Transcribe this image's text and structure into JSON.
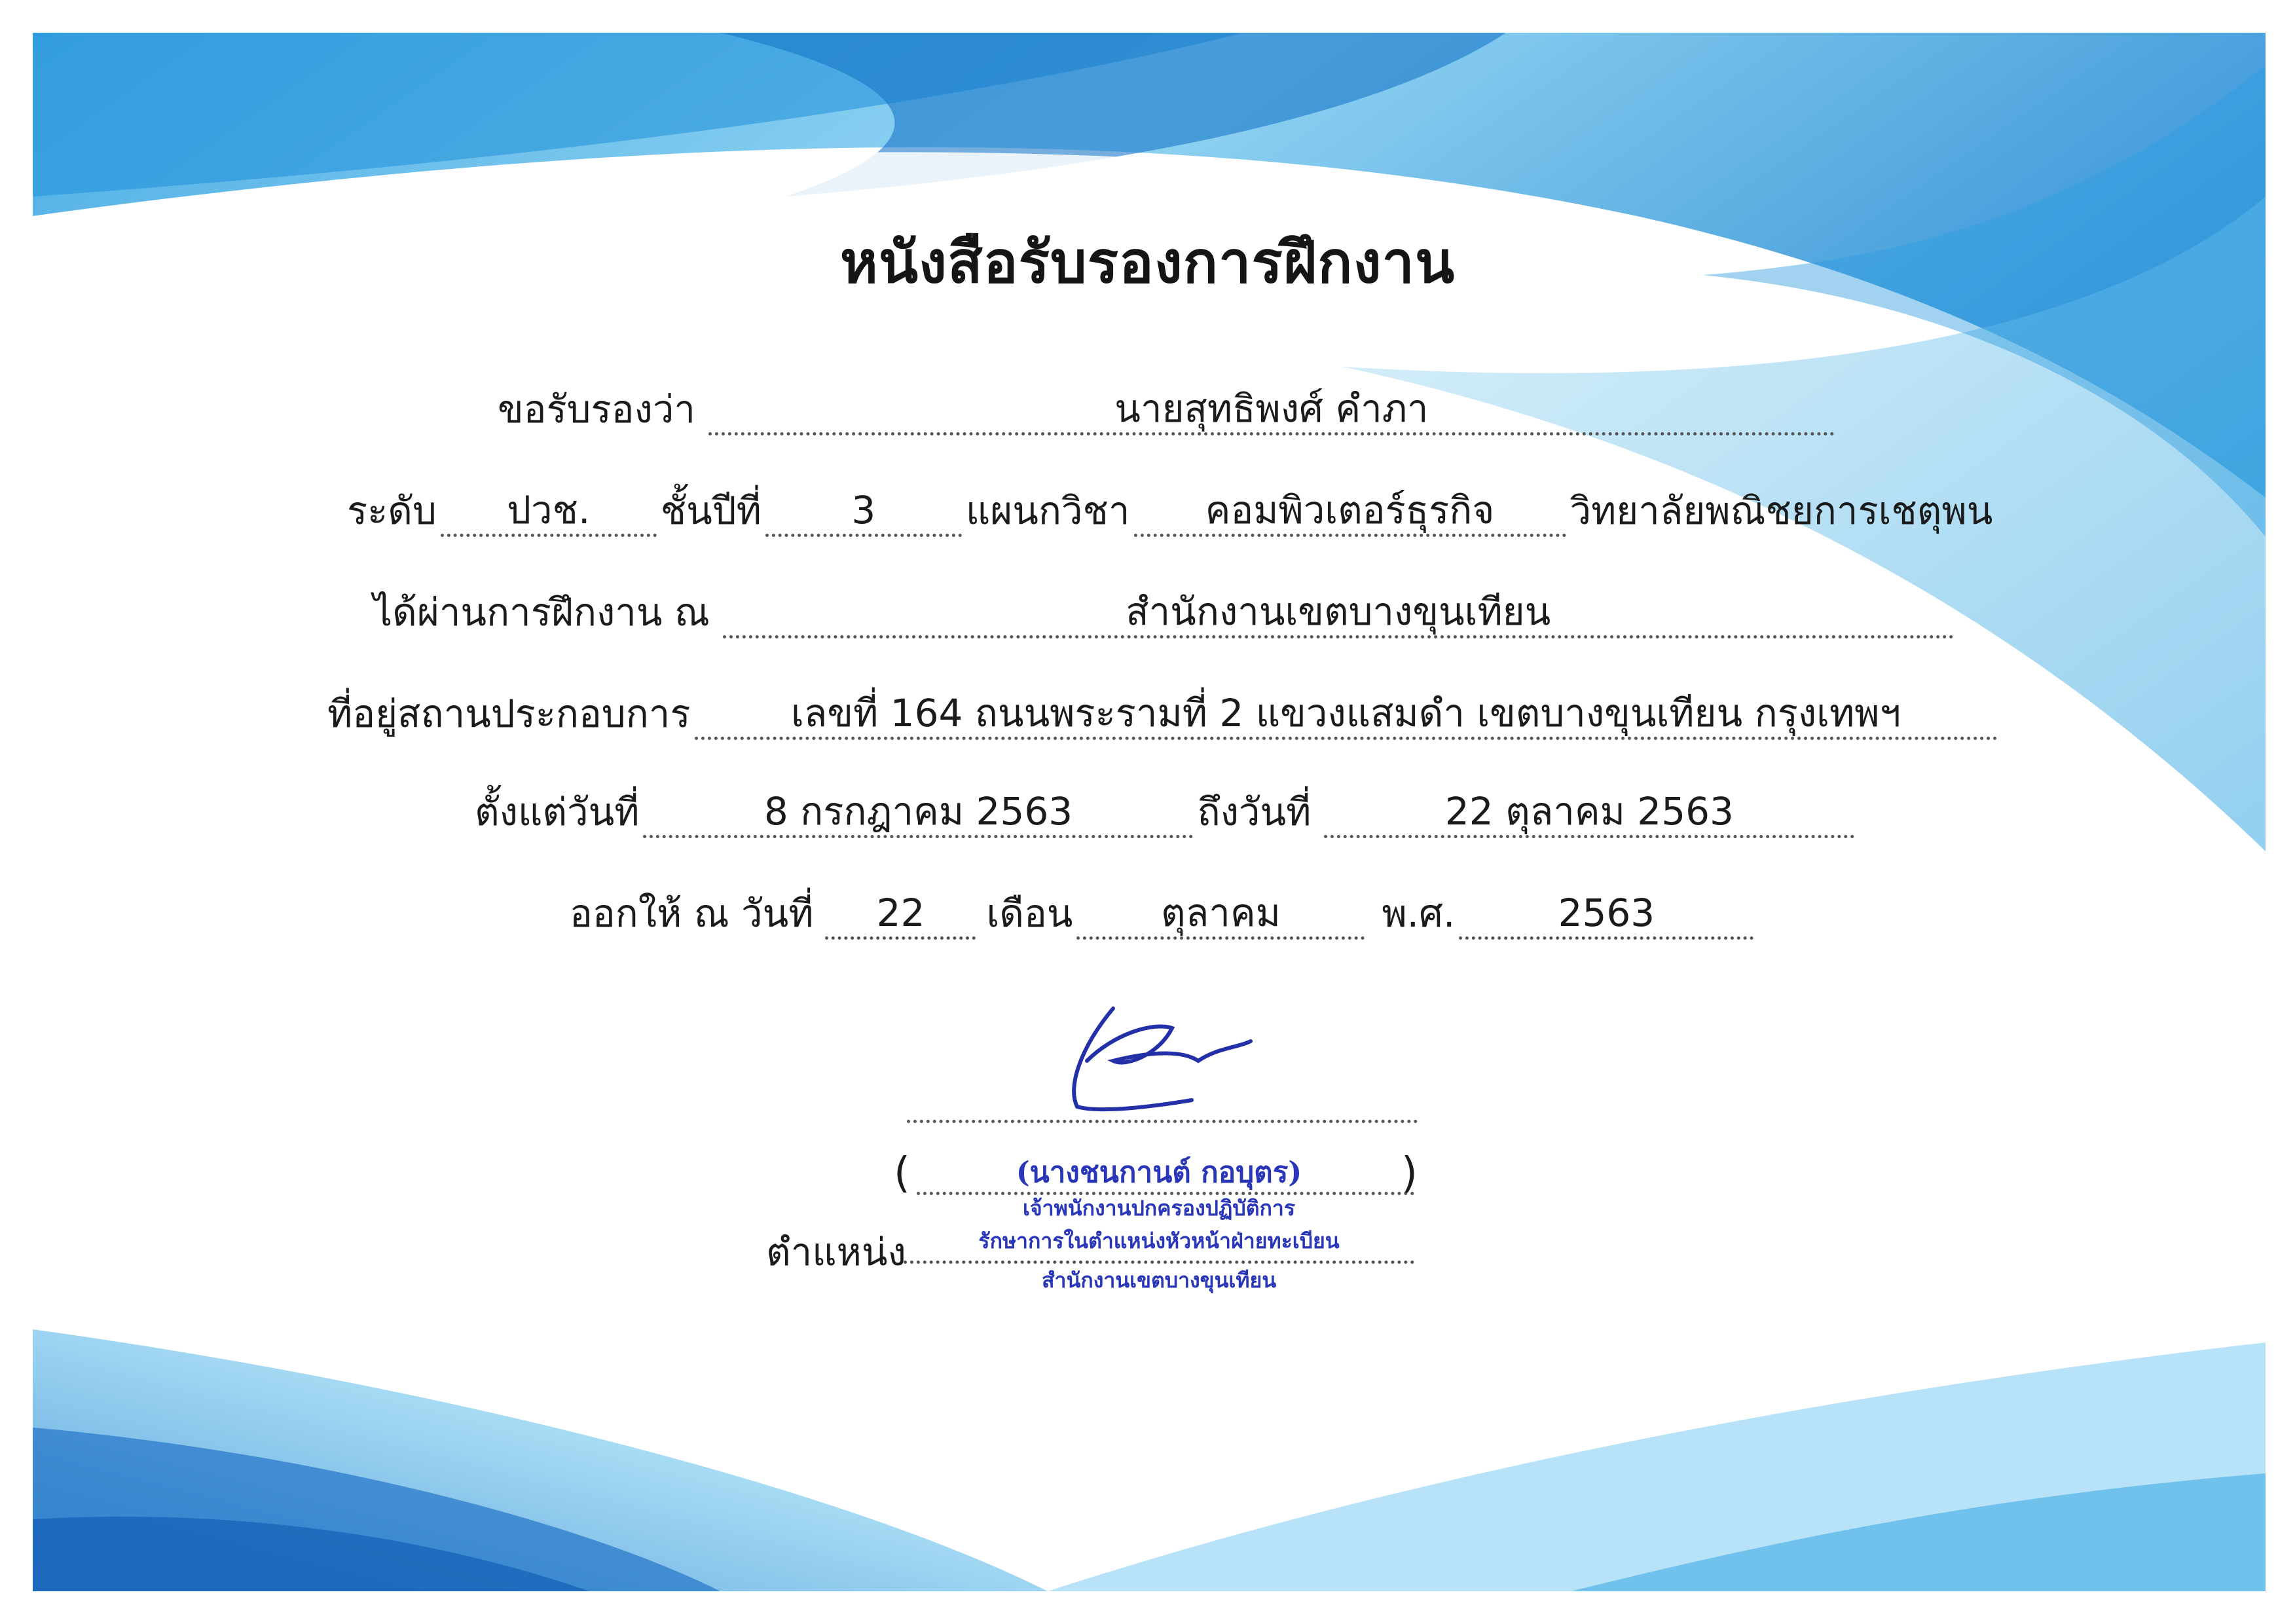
{
  "colors": {
    "wave_dark": "#1f8fd8",
    "wave_mid": "#4fb6e8",
    "wave_light": "#bfe6f7",
    "ink": "#1b1b1b",
    "stamp_ink": "#2a36b8"
  },
  "certificate": {
    "title": "หนังสือรับรองการฝึกงาน",
    "certify_label": "ขอรับรองว่า",
    "name": "นายสุทธิพงศ์  คำภา",
    "level_label": "ระดับ",
    "level": "ปวช.",
    "year_label": "ชั้นปีที่",
    "year": "3",
    "department_label": "แผนกวิชา",
    "department": "คอมพิวเตอร์ธุรกิจ",
    "college": "วิทยาลัยพณิชยการเชตุพน",
    "passed_label": "ได้ผ่านการฝึกงาน ณ",
    "workplace": "สำนักงานเขตบางขุนเทียน",
    "address_label": "ที่อยู่สถานประกอบการ",
    "address": "เลขที่ 164 ถนนพระรามที่ 2 แขวงแสมดำ เขตบางขุนเทียน กรุงเทพฯ",
    "from_label": "ตั้งแต่วันที่",
    "from_date": "8 กรกฎาคม 2563",
    "to_label": "ถึงวันที่",
    "to_date": "22 ตุลาคม 2563",
    "issued_label": "ออกให้ ณ วันที่",
    "issued_day": "22",
    "month_label": "เดือน",
    "issued_month": "ตุลาคม",
    "be_label": "พ.ศ.",
    "issued_year": "2563"
  },
  "signature": {
    "open_paren": "(",
    "close_paren": ")",
    "signer_name": "(นางชนกานต์  กอบุตร)",
    "position_label": "ตำแหน่ง",
    "position_line1": "เจ้าพนักงานปกครองปฏิบัติการ",
    "position_line2": "รักษาการในตำแหน่งหัวหน้าฝ่ายทะเบียน",
    "position_line3": "สำนักงานเขตบางขุนเทียน"
  }
}
